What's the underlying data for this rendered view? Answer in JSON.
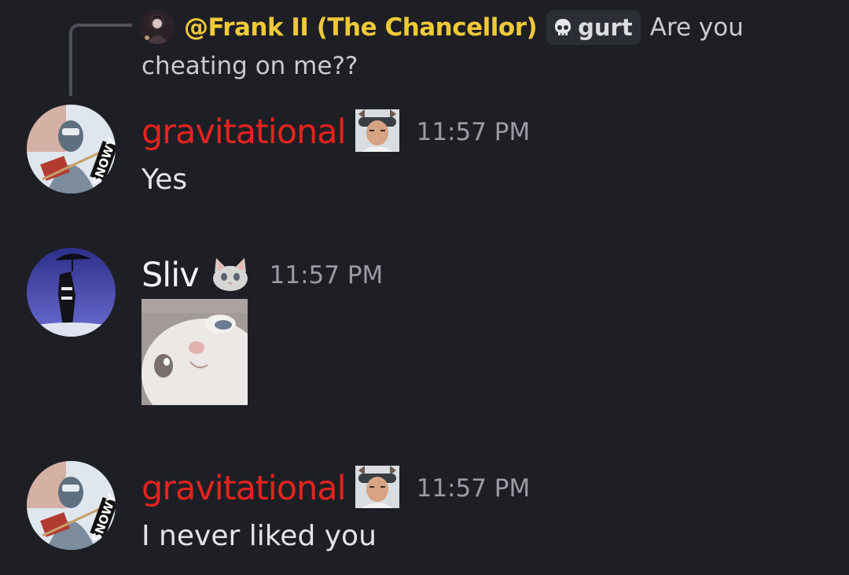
{
  "reply": {
    "author": "@Frank II (The Chancellor)",
    "tag_icon": "skull-icon",
    "tag_label": "gurt",
    "text_line1": "Are you",
    "text_line2": "cheating on me??"
  },
  "messages": [
    {
      "author": "gravitational",
      "author_color": "#e5231f",
      "badge_icon": "man-face-icon",
      "timestamp": "11:57 PM",
      "text": "Yes",
      "avatar_text": "SNOWY"
    },
    {
      "author": "Sliv",
      "author_color": "#f2f3f5",
      "badge_icon": "cat-icon",
      "timestamp": "11:57 PM",
      "attachment": "cat-close-up-image"
    },
    {
      "author": "gravitational",
      "author_color": "#e5231f",
      "badge_icon": "man-face-icon",
      "timestamp": "11:57 PM",
      "text": "I never liked you",
      "avatar_text": "SNOWY"
    }
  ]
}
